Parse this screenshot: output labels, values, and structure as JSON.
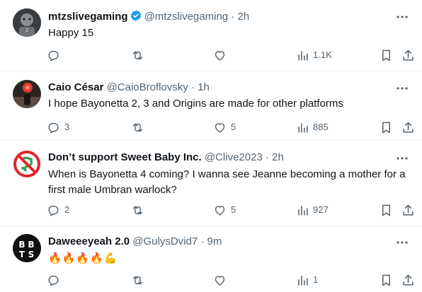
{
  "posts": [
    {
      "name": "mtzslivegaming",
      "handle": "@mtzslivegaming",
      "time": "2h",
      "verified": true,
      "text": "Happy 15",
      "replies": "",
      "reposts": "",
      "likes": "",
      "views": "1.1K",
      "avatar_icon": "gamer-avatar"
    },
    {
      "name": "Caio César",
      "handle": "@CaioBroflovsky",
      "time": "1h",
      "verified": false,
      "text": "I hope Bayonetta 2, 3 and Origins are made for other platforms",
      "replies": "3",
      "reposts": "",
      "likes": "5",
      "views": "885",
      "avatar_icon": "red-light-avatar"
    },
    {
      "name": "Don’t support Sweet Baby Inc.",
      "handle": "@Clive2023",
      "time": "2h",
      "verified": false,
      "text": "When is Bayonetta 4 coming? I wanna see Jeanne becoming a mother for a first male Umbran warlock?",
      "replies": "2",
      "reposts": "",
      "likes": "5",
      "views": "927",
      "avatar_icon": "prohibited-sign-avatar"
    },
    {
      "name": "Daweeeyeah 2.0",
      "handle": "@GulysDvid7",
      "time": "9m",
      "verified": false,
      "text": "🔥🔥🔥🔥💪",
      "replies": "",
      "reposts": "",
      "likes": "",
      "views": "1",
      "avatar_icon": "bbts-logo-avatar"
    }
  ],
  "separator": "·",
  "colors": {
    "text": "#0f1419",
    "secondary": "#536471",
    "verified": "#1d9bf0",
    "divider": "#eff3f4"
  }
}
